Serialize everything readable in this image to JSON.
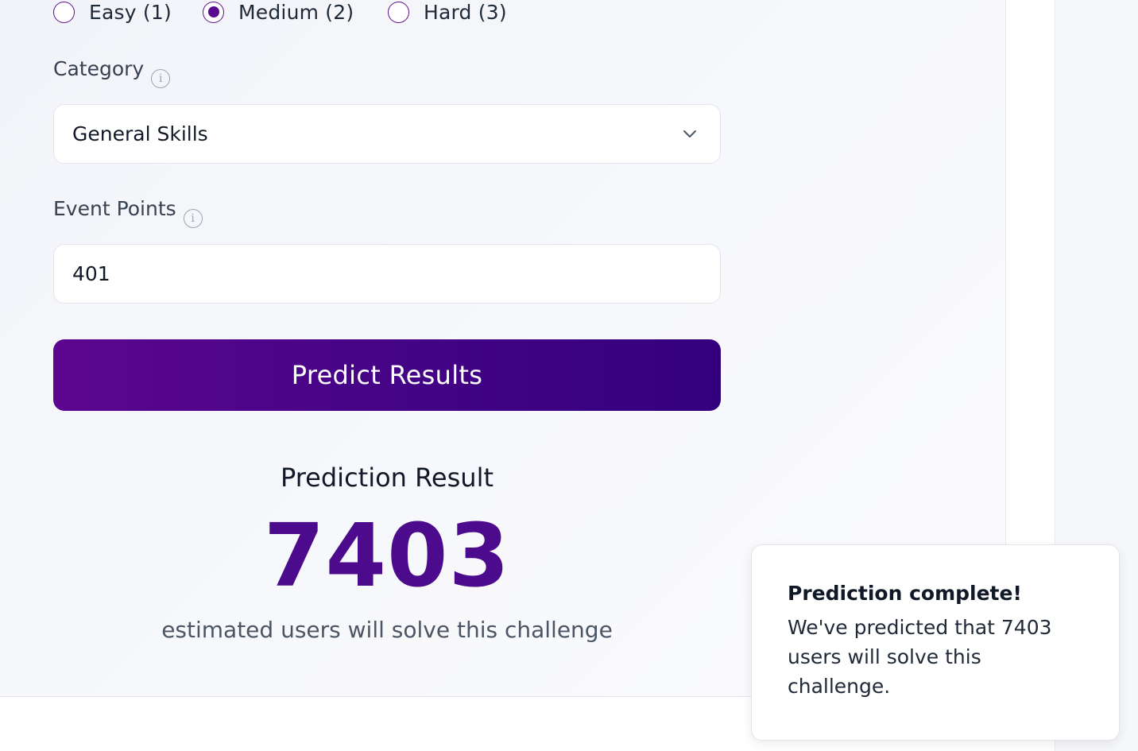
{
  "difficulty": {
    "options": [
      {
        "label": "Easy (1)",
        "selected": false
      },
      {
        "label": "Medium (2)",
        "selected": true
      },
      {
        "label": "Hard (3)",
        "selected": false
      }
    ]
  },
  "category": {
    "label": "Category",
    "selected_value": "General Skills",
    "info_icon": "i"
  },
  "event_points": {
    "label": "Event Points",
    "value": "401",
    "info_icon": "i"
  },
  "predict_button": {
    "label": "Predict Results"
  },
  "result": {
    "title": "Prediction Result",
    "value": "7403",
    "caption": "estimated users will solve this challenge"
  },
  "toast": {
    "title": "Prediction complete!",
    "message": "We've predicted that 7403 users will solve this challenge."
  },
  "colors": {
    "accent": "#5a0a8f",
    "button_start": "#5c068f",
    "button_end": "#33007d",
    "result_value": "#4c0a8c"
  }
}
